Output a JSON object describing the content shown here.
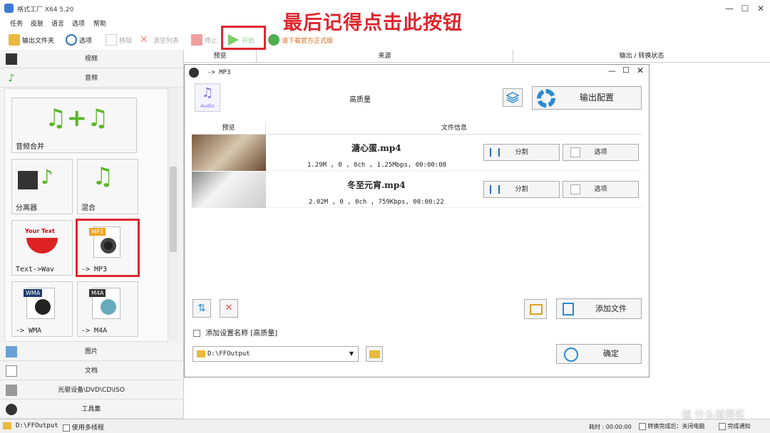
{
  "window": {
    "title": "格式工厂 X64 5.20",
    "min": "—",
    "max": "☐",
    "close": "✕"
  },
  "menu": [
    "任务",
    "皮肤",
    "语言",
    "选项",
    "帮助"
  ],
  "toolbar": {
    "output_folder": "输出文件夹",
    "options": "选项",
    "remove": "移除",
    "clear": "清空列表",
    "stop": "停止",
    "start": "开始",
    "download": "请下载官方正式版"
  },
  "annotation": "最后记得点击此按钮",
  "sidebar": {
    "video": "视频",
    "audio": "音频",
    "tiles": [
      "音频合并",
      "分离器",
      "混合",
      "Text->Wav",
      "-> MP3",
      "-> WMA",
      "-> M4A"
    ],
    "tile_badges": {
      "text": "Your Text",
      "mp3": "MP3",
      "wma": "WMA",
      "m4a": "M4A"
    },
    "image": "图片",
    "document": "文档",
    "optical": "光驱设备\\DVD\\CD\\ISO",
    "tools": "工具集"
  },
  "columns": [
    "预览",
    "来源",
    "输出 / 转换状态"
  ],
  "dialog": {
    "title": "-> MP3",
    "quality": "高质量",
    "output_config": "输出配置",
    "audio_badge": "Audio",
    "col_preview": "预览",
    "col_info": "文件信息",
    "files": [
      {
        "name": "溏心蛋.mp4",
        "info": "1.29M , 0 , 0ch , 1.25Mbps, 00:00:08",
        "split": "分割",
        "options": "选项"
      },
      {
        "name": "冬至元宵.mp4",
        "info": "2.02M , 0 , 0ch , 759Kbps, 00:00:22",
        "split": "分割",
        "options": "选项"
      }
    ],
    "add_file": "添加文件",
    "add_setting_name": "添加设置名称 [高质量]",
    "output_path": "D:\\FFOutput",
    "ok": "确定"
  },
  "status": {
    "path": "D:\\FFOutput",
    "multithread": "使用多线程",
    "elapsed": "耗时 : 00:00:00",
    "shutdown": "转换完成后：关闭电脑",
    "notify": "完成通知",
    "watermark": "值 什么值得买"
  }
}
